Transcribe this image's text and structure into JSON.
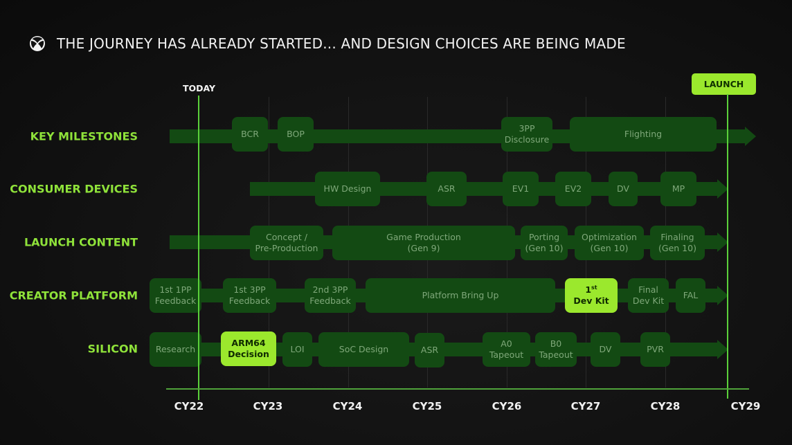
{
  "header": {
    "logo_icon": "xbox-logo-icon",
    "title": "THE JOURNEY HAS ALREADY STARTED... AND DESIGN CHOICES ARE BEING MADE"
  },
  "markers": {
    "today_label": "TODAY",
    "launch_label": "LAUNCH"
  },
  "colors": {
    "accent": "#9be82d",
    "row_label": "#8fe23a",
    "bar": "#134a13",
    "box_text": "#7fa87a",
    "background": "#121212"
  },
  "axis": {
    "ticks": [
      "CY22",
      "CY23",
      "CY24",
      "CY25",
      "CY26",
      "CY27",
      "CY28",
      "CY29"
    ]
  },
  "rows": [
    {
      "label": "KEY MILESTONES",
      "items": [
        {
          "text": "BCR"
        },
        {
          "text": "BOP"
        },
        {
          "text": "3PP\nDisclosure"
        },
        {
          "text": "Flighting"
        }
      ]
    },
    {
      "label": "CONSUMER DEVICES",
      "items": [
        {
          "text": "HW Design"
        },
        {
          "text": "ASR"
        },
        {
          "text": "EV1"
        },
        {
          "text": "EV2"
        },
        {
          "text": "DV"
        },
        {
          "text": "MP"
        }
      ]
    },
    {
      "label": "LAUNCH CONTENT",
      "items": [
        {
          "text": "Concept /\nPre-Production"
        },
        {
          "text": "Game Production\n(Gen 9)"
        },
        {
          "text": "Porting\n(Gen 10)"
        },
        {
          "text": "Optimization\n(Gen 10)"
        },
        {
          "text": "Finaling\n(Gen 10)"
        }
      ]
    },
    {
      "label": "CREATOR PLATFORM",
      "items": [
        {
          "text": "1st 1PP\nFeedback"
        },
        {
          "text": "1st 3PP\nFeedback"
        },
        {
          "text": "2nd 3PP\nFeedback"
        },
        {
          "text": "Platform Bring Up"
        },
        {
          "text_main": "1",
          "text_sup": "st",
          "text_line2": "Dev Kit",
          "highlight": true
        },
        {
          "text": "Final\nDev Kit"
        },
        {
          "text": "FAL"
        }
      ]
    },
    {
      "label": "SILICON",
      "items": [
        {
          "text": "Research"
        },
        {
          "text": "ARM64\nDecision",
          "highlight": true
        },
        {
          "text": "LOI"
        },
        {
          "text": "SoC Design"
        },
        {
          "text": "ASR"
        },
        {
          "text": "A0\nTapeout"
        },
        {
          "text": "B0\nTapeout"
        },
        {
          "text": "DV"
        },
        {
          "text": "PVR"
        }
      ]
    }
  ]
}
